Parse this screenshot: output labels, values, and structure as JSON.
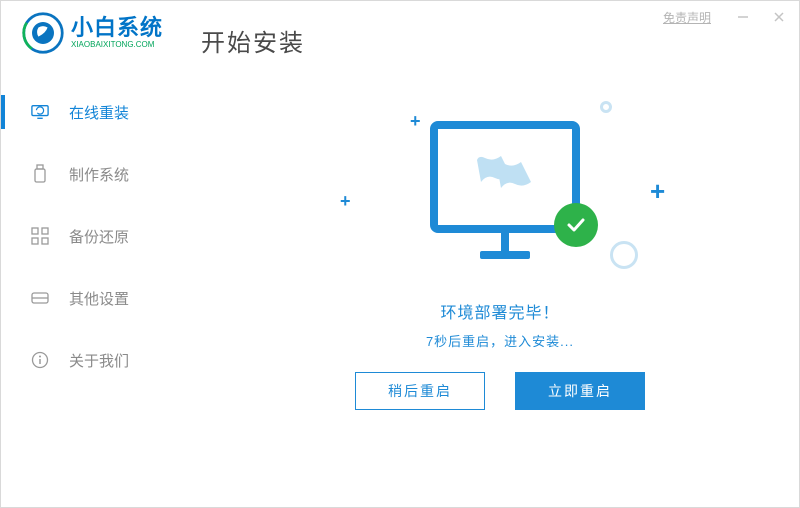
{
  "titlebar": {
    "disclaimer": "免责声明"
  },
  "brand": {
    "title": "小白系统",
    "subtitle": "XIAOBAIXITONG.COM"
  },
  "page_title": "开始安装",
  "sidebar": {
    "items": [
      {
        "label": "在线重装",
        "icon": "monitor-refresh-icon",
        "active": true
      },
      {
        "label": "制作系统",
        "icon": "usb-icon",
        "active": false
      },
      {
        "label": "备份还原",
        "icon": "grid-icon",
        "active": false
      },
      {
        "label": "其他设置",
        "icon": "drive-icon",
        "active": false
      },
      {
        "label": "关于我们",
        "icon": "info-icon",
        "active": false
      }
    ]
  },
  "status": {
    "title": "环境部署完毕！",
    "subtitle": "7秒后重启，进入安装..."
  },
  "buttons": {
    "later": "稍后重启",
    "now": "立即重启"
  }
}
